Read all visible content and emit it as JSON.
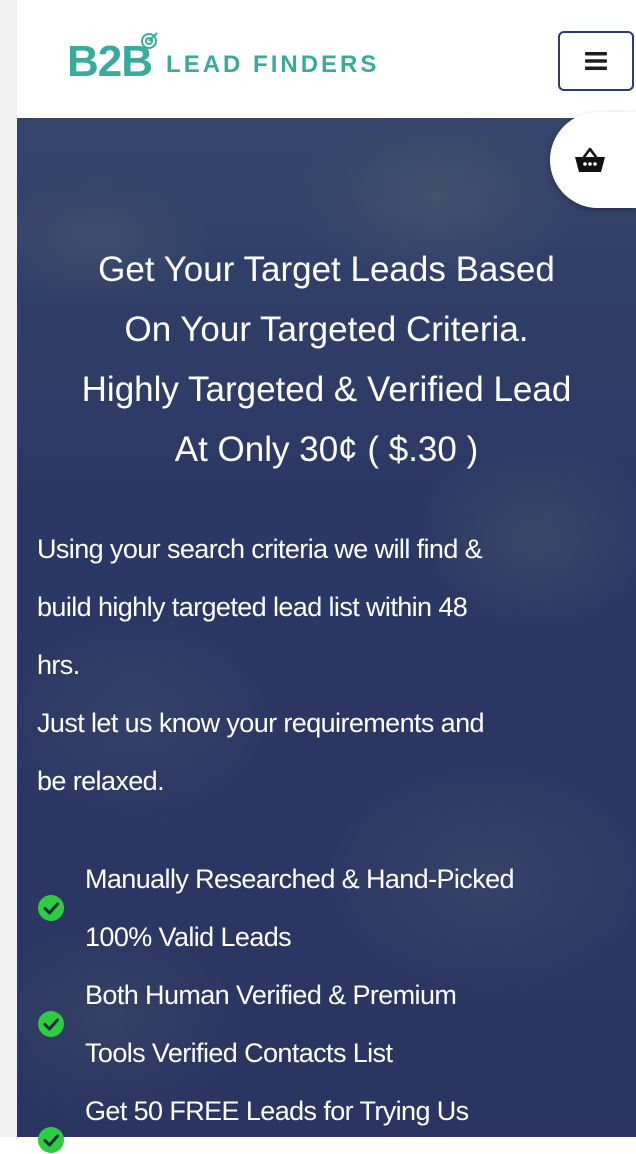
{
  "header": {
    "logo_mark": "B2B",
    "logo_text": "LEAD FINDERS",
    "menu_icon": "hamburger-icon"
  },
  "cart": {
    "icon": "basket-icon"
  },
  "hero": {
    "title_lines": [
      "Get Your Target Leads Based",
      "On Your Targeted Criteria.",
      "Highly Targeted & Verified Lead",
      "At Only 30¢ ( $.30 )"
    ],
    "description_lines": [
      "Using your search criteria we will find &",
      "build highly targeted lead list within 48",
      "hrs.",
      "Just let us know your requirements and",
      "be relaxed."
    ]
  },
  "features": [
    {
      "lines": [
        "Manually Researched & Hand-Picked",
        "100% Valid Leads"
      ]
    },
    {
      "lines": [
        "Both Human Verified & Premium",
        "Tools Verified Contacts List"
      ]
    },
    {
      "lines": [
        "Get 50 FREE Leads for Trying Us"
      ]
    }
  ],
  "colors": {
    "brand": "#3aab9a",
    "hero_background": "#2e3a66",
    "check": "#2ecc40"
  }
}
